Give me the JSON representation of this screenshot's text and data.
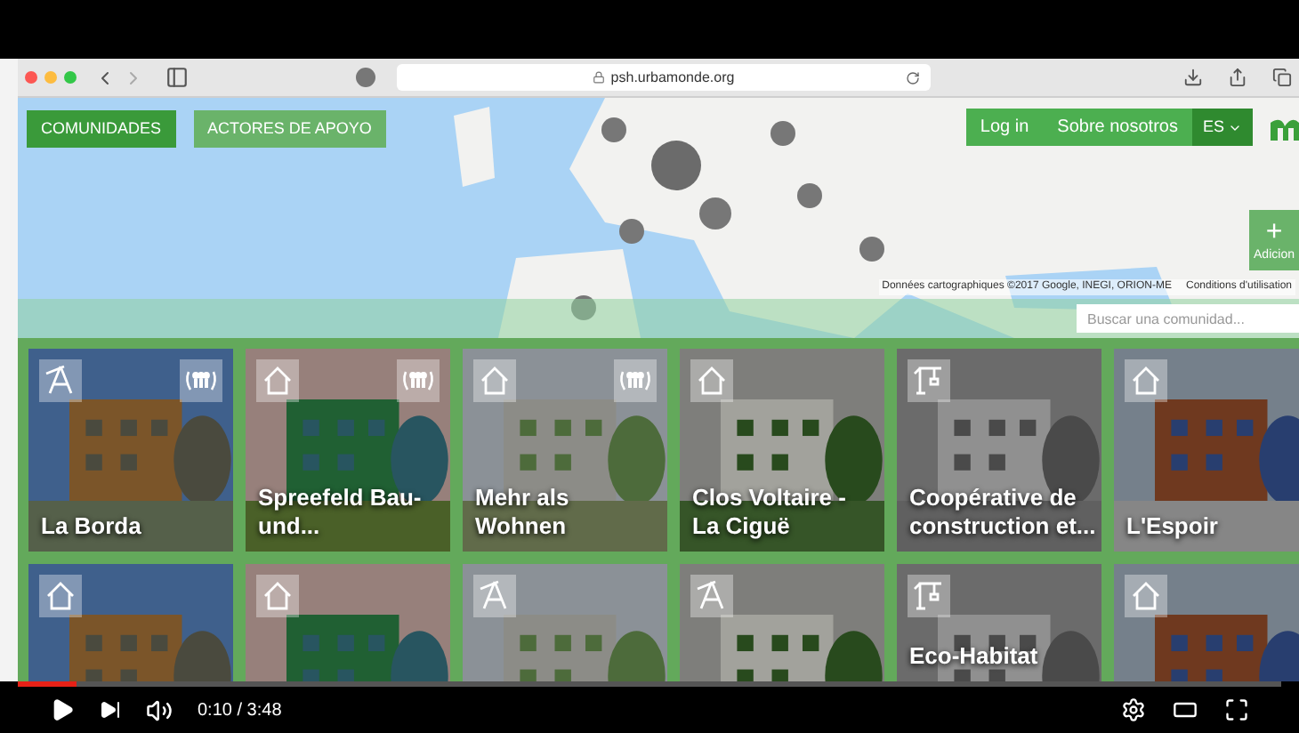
{
  "browser": {
    "url": "psh.urbamonde.org"
  },
  "map": {
    "attribution": "Données cartographiques ©2017 Google, INEGI, ORION-ME",
    "terms": "Conditions d'utilisation",
    "search": {
      "placeholder": "Buscar una comunidad..."
    }
  },
  "view_tabs": [
    {
      "label": "COMUNIDADES",
      "selected": true
    },
    {
      "label": "ACTORES DE APOYO",
      "selected": false
    }
  ],
  "nav": [
    {
      "label": "Log in",
      "kind": "link"
    },
    {
      "label": "Sobre nosotros",
      "kind": "link"
    },
    {
      "label": "ES",
      "kind": "dropdown"
    }
  ],
  "add_button": {
    "icon": "+",
    "label": "Adicion"
  },
  "tiles": [
    {
      "title": "La Borda",
      "kind": "compass",
      "badge": true
    },
    {
      "title": "Spreefeld Bau-und...",
      "kind": "house",
      "badge": true
    },
    {
      "title": "Mehr als Wohnen",
      "kind": "house",
      "badge": true
    },
    {
      "title": "Clos Voltaire - La Ciguë",
      "kind": "house",
      "badge": false
    },
    {
      "title": "Coopérative de construction et...",
      "kind": "crane",
      "badge": false
    },
    {
      "title": "L'Espoir",
      "kind": "house",
      "badge": false
    },
    {
      "kind": "house",
      "badge": false
    },
    {
      "kind": "house",
      "badge": false
    },
    {
      "kind": "compass",
      "badge": false
    },
    {
      "kind": "compass",
      "badge": false
    },
    {
      "title": "Eco-Habitat",
      "kind": "crane",
      "badge": false
    },
    {
      "kind": "house",
      "badge": false
    }
  ],
  "player": {
    "level": 0.047,
    "time": "0:10 / 3:48"
  }
}
